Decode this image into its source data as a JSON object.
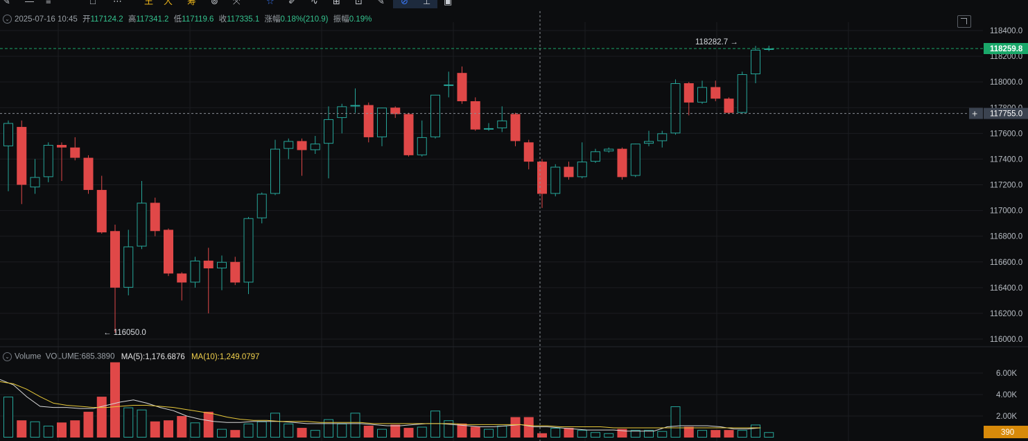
{
  "toolbar": {
    "icons": [
      "pencil-icon",
      "horizontal-line-icon",
      "menu-lines-icon",
      "square-icon",
      "more-dots-icon",
      "fib-icon",
      "fan-icon",
      "channel-icon",
      "circle-icon",
      "measure-icon",
      "bookmark-icon",
      "brush-icon",
      "wave-icon",
      "pattern-icon",
      "text-icon",
      "edit-icon",
      "magnet-icon",
      "lock-icon",
      "trash-icon"
    ],
    "gold_labels": [
      "王",
      "大",
      "筹"
    ]
  },
  "info": {
    "date": "2025-07-16 10:45",
    "open_label": "开",
    "open": "117124.2",
    "high_label": "高",
    "high": "117341.2",
    "low_label": "低",
    "low": "117119.6",
    "close_label": "收",
    "close": "117335.1",
    "change_label": "涨幅",
    "change": "0.18%(210.9)",
    "amp_label": "振幅",
    "amp": "0.19%"
  },
  "volume_info": {
    "label": "Volume",
    "volume": "VOLUME:685.3890",
    "ma5": "MA(5):1,176.6876",
    "ma10": "MA(10):1,249.0797"
  },
  "colors": {
    "up": "#26a69a",
    "down": "#e04848",
    "bg": "#0c0d0f",
    "grid": "#1b1d21",
    "price_tag": "#1aa86a",
    "vol_tag": "#d88a0a",
    "crosshair_tag": "#3b4350"
  },
  "chart_data": {
    "type": "candlestick",
    "price_axis": {
      "min": 116000,
      "max": 118400,
      "ticks": [
        "118400.0",
        "118200.0",
        "118000.0",
        "117800.0",
        "117600.0",
        "117400.0",
        "117200.0",
        "117000.0",
        "116800.0",
        "116600.0",
        "116400.0",
        "116200.0",
        "116000.0"
      ]
    },
    "volume_axis": {
      "ticks": [
        "6.00K",
        "4.00K",
        "2.00K"
      ]
    },
    "current_price_label": "118259.8",
    "crosshair_price_label": "117755.0",
    "crosshair_volume_label": "390",
    "high_marker": "118282.7 →",
    "low_marker": "← 116050.0",
    "candles": [
      {
        "o": 117500,
        "h": 117700,
        "l": 117150,
        "c": 117680
      },
      {
        "o": 117650,
        "h": 117700,
        "l": 117050,
        "c": 117200
      },
      {
        "o": 117180,
        "h": 117400,
        "l": 117130,
        "c": 117260
      },
      {
        "o": 117260,
        "h": 117530,
        "l": 117220,
        "c": 117510
      },
      {
        "o": 117510,
        "h": 117530,
        "l": 117230,
        "c": 117490
      },
      {
        "o": 117490,
        "h": 117570,
        "l": 117390,
        "c": 117410
      },
      {
        "o": 117410,
        "h": 117430,
        "l": 117130,
        "c": 117160
      },
      {
        "o": 117160,
        "h": 117270,
        "l": 116820,
        "c": 116830
      },
      {
        "o": 116840,
        "h": 116890,
        "l": 116050,
        "c": 116400
      },
      {
        "o": 116400,
        "h": 116850,
        "l": 116340,
        "c": 116720
      },
      {
        "o": 116720,
        "h": 117230,
        "l": 116700,
        "c": 117060
      },
      {
        "o": 117060,
        "h": 117100,
        "l": 116800,
        "c": 116840
      },
      {
        "o": 116850,
        "h": 116860,
        "l": 116490,
        "c": 116510
      },
      {
        "o": 116510,
        "h": 116520,
        "l": 116300,
        "c": 116440
      },
      {
        "o": 116440,
        "h": 116640,
        "l": 116400,
        "c": 116610
      },
      {
        "o": 116610,
        "h": 116710,
        "l": 116200,
        "c": 116550
      },
      {
        "o": 116550,
        "h": 116650,
        "l": 116380,
        "c": 116600
      },
      {
        "o": 116600,
        "h": 116640,
        "l": 116420,
        "c": 116440
      },
      {
        "o": 116440,
        "h": 116950,
        "l": 116350,
        "c": 116940
      },
      {
        "o": 116940,
        "h": 117140,
        "l": 116900,
        "c": 117130
      },
      {
        "o": 117130,
        "h": 117550,
        "l": 117120,
        "c": 117480
      },
      {
        "o": 117480,
        "h": 117560,
        "l": 117400,
        "c": 117540
      },
      {
        "o": 117540,
        "h": 117560,
        "l": 117270,
        "c": 117470
      },
      {
        "o": 117470,
        "h": 117580,
        "l": 117440,
        "c": 117520
      },
      {
        "o": 117520,
        "h": 117810,
        "l": 117250,
        "c": 117710
      },
      {
        "o": 117720,
        "h": 117830,
        "l": 117600,
        "c": 117810
      },
      {
        "o": 117810,
        "h": 117950,
        "l": 117760,
        "c": 117820
      },
      {
        "o": 117820,
        "h": 117840,
        "l": 117530,
        "c": 117570
      },
      {
        "o": 117570,
        "h": 117800,
        "l": 117500,
        "c": 117800
      },
      {
        "o": 117800,
        "h": 117810,
        "l": 117720,
        "c": 117750
      },
      {
        "o": 117750,
        "h": 117760,
        "l": 117420,
        "c": 117430
      },
      {
        "o": 117430,
        "h": 117700,
        "l": 117420,
        "c": 117570
      },
      {
        "o": 117570,
        "h": 117900,
        "l": 117560,
        "c": 117900
      },
      {
        "o": 117970,
        "h": 118080,
        "l": 117880,
        "c": 117980
      },
      {
        "o": 118070,
        "h": 118120,
        "l": 117830,
        "c": 117850
      },
      {
        "o": 117850,
        "h": 117880,
        "l": 117620,
        "c": 117630
      },
      {
        "o": 117630,
        "h": 117680,
        "l": 117620,
        "c": 117640
      },
      {
        "o": 117640,
        "h": 117810,
        "l": 117610,
        "c": 117700
      },
      {
        "o": 117750,
        "h": 117760,
        "l": 117500,
        "c": 117540
      },
      {
        "o": 117530,
        "h": 117550,
        "l": 117320,
        "c": 117380
      },
      {
        "o": 117380,
        "h": 117400,
        "l": 117020,
        "c": 117130
      },
      {
        "o": 117130,
        "h": 117360,
        "l": 117110,
        "c": 117340
      },
      {
        "o": 117340,
        "h": 117380,
        "l": 117240,
        "c": 117260
      },
      {
        "o": 117260,
        "h": 117530,
        "l": 117250,
        "c": 117380
      },
      {
        "o": 117380,
        "h": 117480,
        "l": 117370,
        "c": 117460
      },
      {
        "o": 117460,
        "h": 117490,
        "l": 117450,
        "c": 117480
      },
      {
        "o": 117480,
        "h": 117490,
        "l": 117240,
        "c": 117260
      },
      {
        "o": 117270,
        "h": 117520,
        "l": 117260,
        "c": 117520
      },
      {
        "o": 117520,
        "h": 117620,
        "l": 117500,
        "c": 117540
      },
      {
        "o": 117540,
        "h": 117620,
        "l": 117490,
        "c": 117600
      },
      {
        "o": 117600,
        "h": 118020,
        "l": 117590,
        "c": 117990
      },
      {
        "o": 117990,
        "h": 118000,
        "l": 117740,
        "c": 117840
      },
      {
        "o": 117840,
        "h": 118010,
        "l": 117830,
        "c": 117960
      },
      {
        "o": 117960,
        "h": 118010,
        "l": 117850,
        "c": 117870
      },
      {
        "o": 117870,
        "h": 117880,
        "l": 117750,
        "c": 117760
      },
      {
        "o": 117760,
        "h": 118080,
        "l": 117750,
        "c": 118060
      },
      {
        "o": 118060,
        "h": 118280,
        "l": 117990,
        "c": 118250
      },
      {
        "o": 118250,
        "h": 118282,
        "l": 118240,
        "c": 118260
      }
    ],
    "volumes": [
      3800,
      1600,
      1500,
      1100,
      1400,
      1600,
      2400,
      3800,
      7000,
      2800,
      2600,
      1500,
      1600,
      2000,
      1400,
      2400,
      800,
      700,
      1300,
      1500,
      2300,
      1300,
      900,
      700,
      1700,
      1300,
      2300,
      1100,
      800,
      1200,
      900,
      1000,
      2500,
      1600,
      1300,
      1000,
      800,
      1100,
      1900,
      1900,
      400,
      900,
      900,
      700,
      500,
      400,
      800,
      700,
      700,
      600,
      2900,
      1000,
      700,
      700,
      700,
      700,
      1200,
      500
    ],
    "ma5": [
      5400,
      4900,
      3800,
      2900,
      2800,
      2800,
      2700,
      2700,
      3000,
      3300,
      3500,
      3200,
      2800,
      2500,
      2000,
      1700,
      1500,
      1400,
      1400,
      1500,
      1500,
      1500,
      1400,
      1300,
      1300,
      1300,
      1300,
      1300,
      1200,
      1100,
      1100,
      1200,
      1300,
      1300,
      1200,
      1100,
      1000,
      1000,
      1100,
      1200,
      1000,
      1000,
      900,
      800,
      700,
      700,
      700,
      600,
      600,
      600,
      1000,
      1100,
      1100,
      1100,
      1000,
      800,
      800,
      900
    ],
    "ma10": [
      5200,
      5000,
      4500,
      3800,
      3200,
      3000,
      2900,
      2800,
      2800,
      2900,
      3000,
      3000,
      2900,
      2800,
      2600,
      2400,
      2200,
      1900,
      1700,
      1600,
      1600,
      1500,
      1500,
      1500,
      1400,
      1400,
      1400,
      1400,
      1300,
      1300,
      1300,
      1300,
      1300,
      1300,
      1300,
      1200,
      1200,
      1200,
      1200,
      1200,
      1100,
      1100,
      1000,
      1000,
      1000,
      1000,
      900,
      900,
      900,
      900,
      900,
      900,
      900,
      900,
      900,
      900,
      900,
      900
    ]
  }
}
